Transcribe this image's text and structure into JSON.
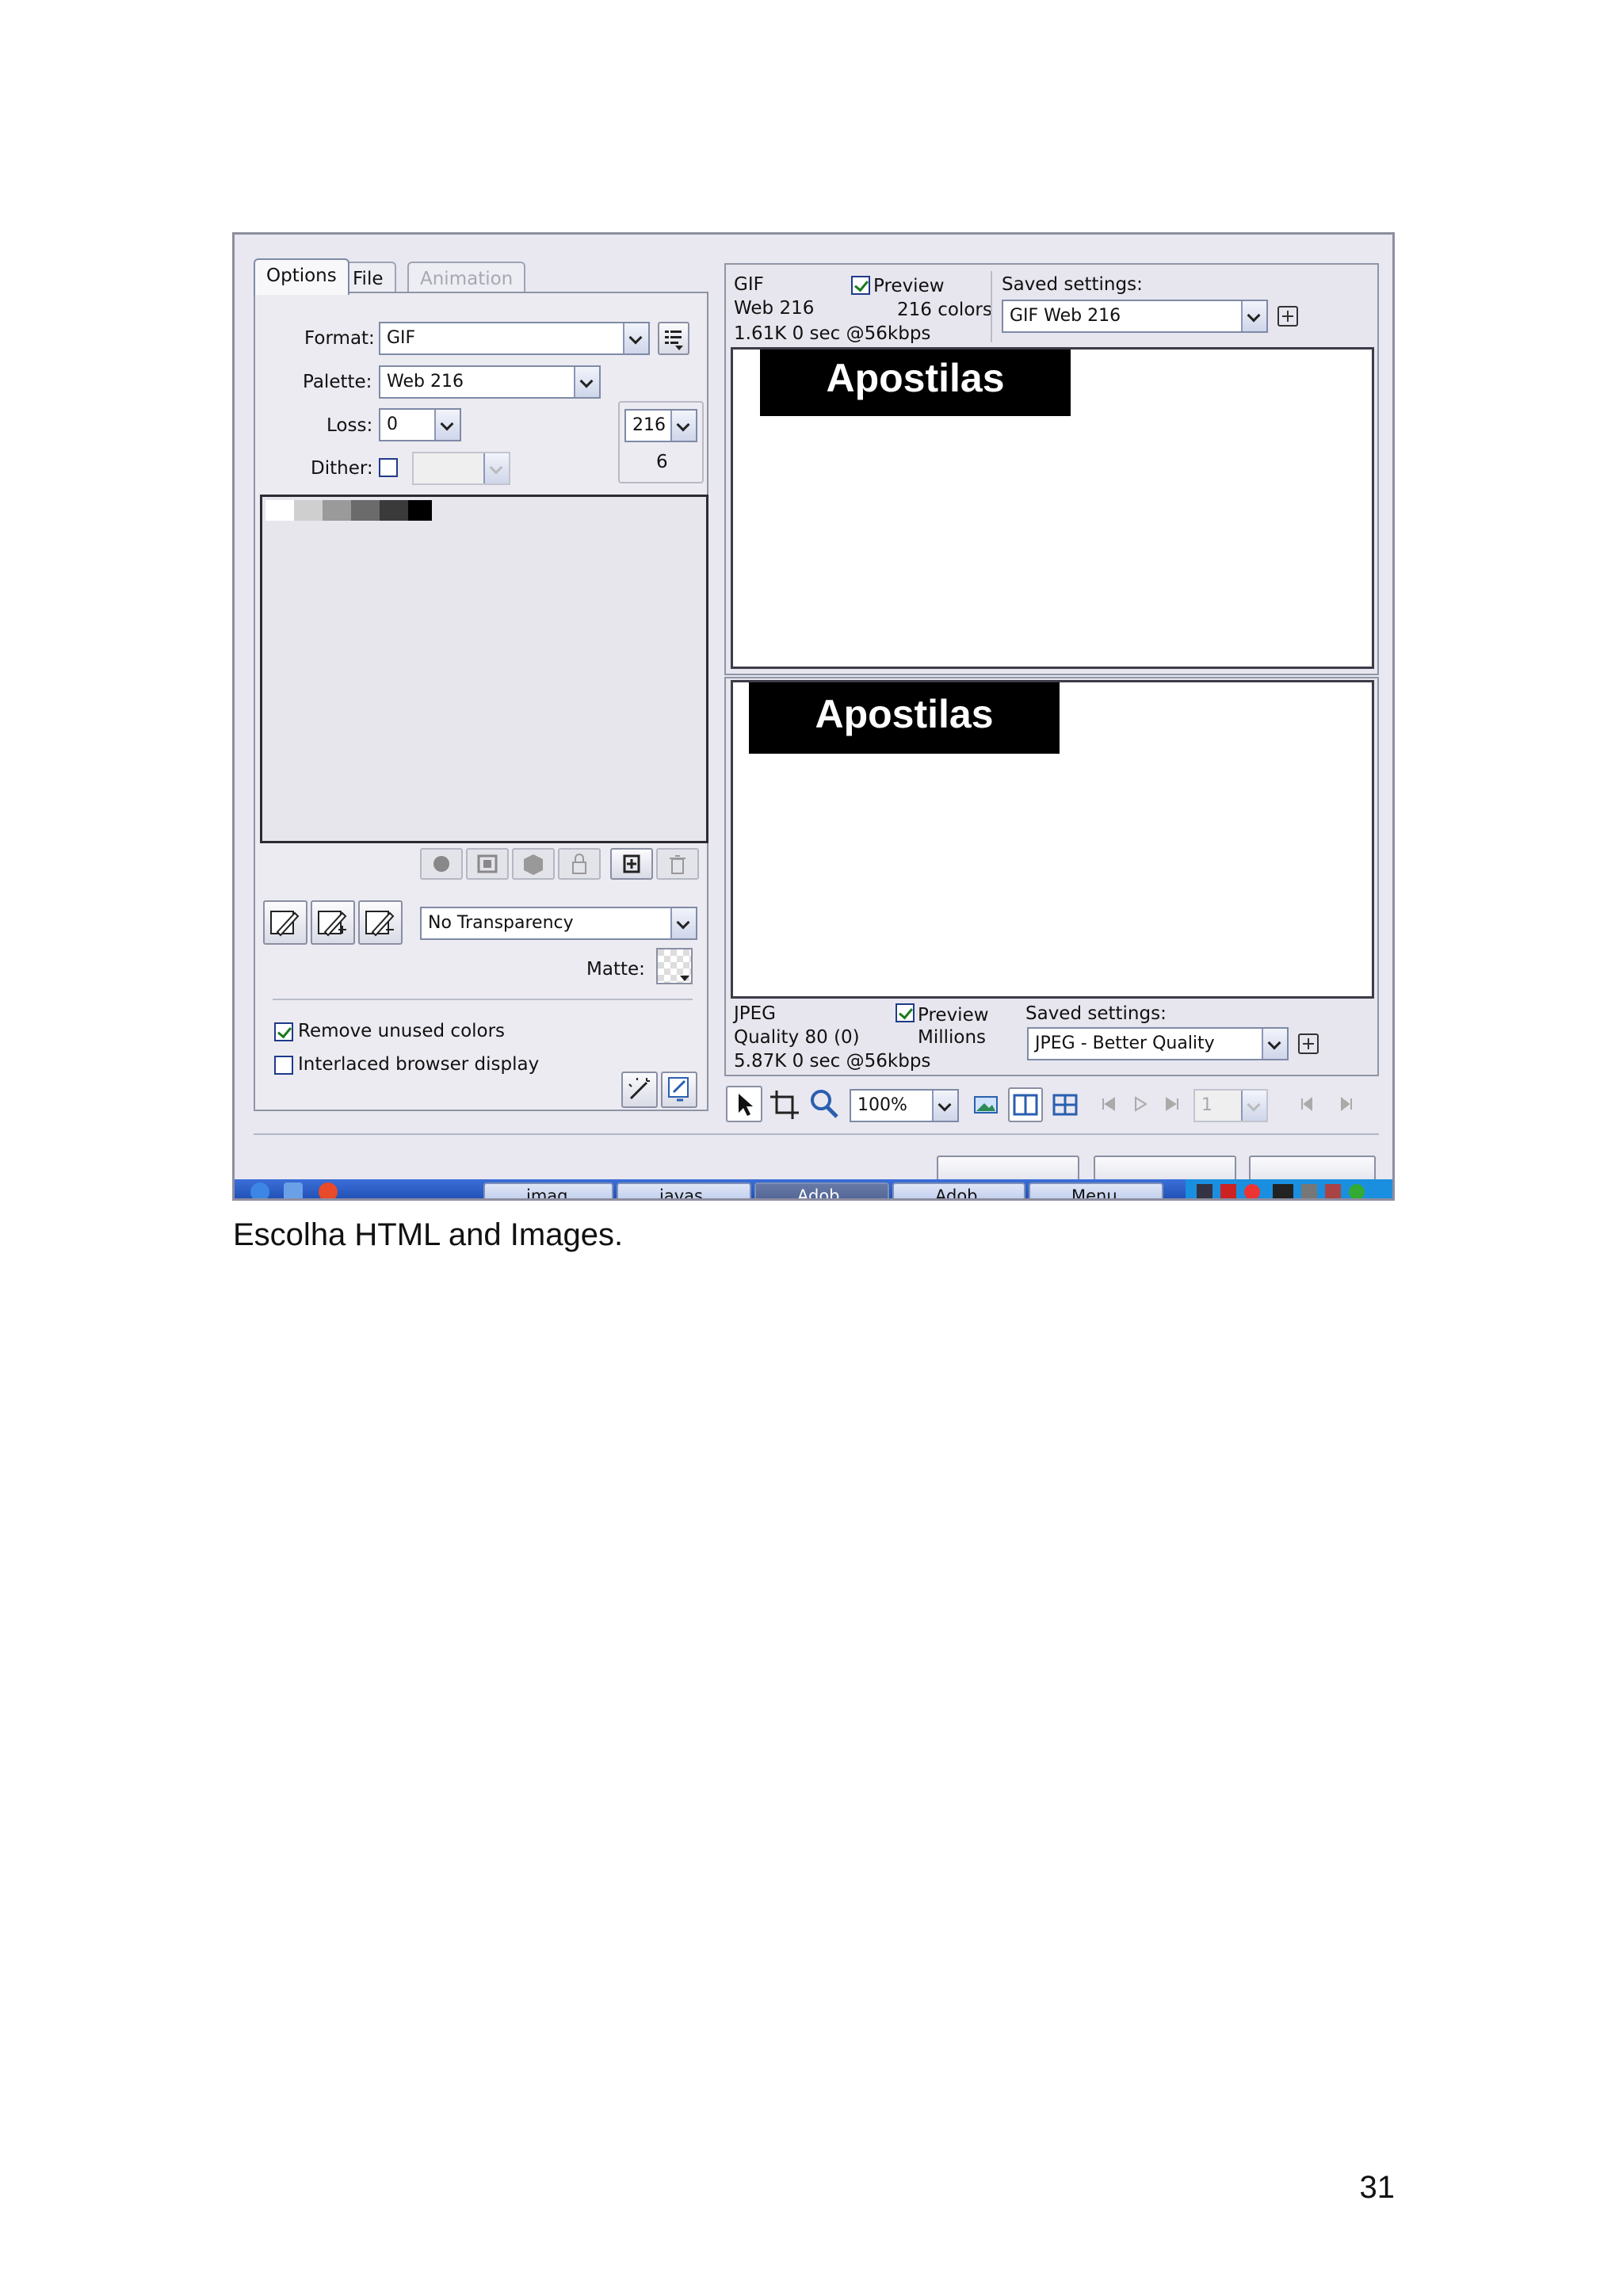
{
  "tabs": [
    "Options",
    "File",
    "Animation"
  ],
  "options": {
    "format_label": "Format:",
    "format_value": "GIF",
    "palette_label": "Palette:",
    "palette_value": "Web 216",
    "loss_label": "Loss:",
    "loss_value": "0",
    "dither_label": "Dither:",
    "colors_value": "216",
    "colors_count": "6",
    "transparency_value": "No Transparency",
    "matte_label": "Matte:",
    "remove_unused": "Remove unused colors",
    "interlaced": "Interlaced browser display"
  },
  "gif_preview": {
    "format": "GIF",
    "palette": "Web 216",
    "colors": "216 colors",
    "stats": "1.61K  0 sec @56kbps",
    "preview_label": "Preview",
    "saved_settings_label": "Saved settings:",
    "saved_settings_value": "GIF Web 216",
    "image_text": "Apostilas"
  },
  "jpeg_preview": {
    "format": "JPEG",
    "quality": "Quality 80 (0)",
    "colors": "Millions",
    "stats": "5.87K  0 sec @56kbps",
    "preview_label": "Preview",
    "saved_settings_label": "Saved settings:",
    "saved_settings_value": "JPEG - Better Quality",
    "image_text": "Apostilas"
  },
  "toolbar": {
    "zoom": "100%",
    "frame": "1"
  },
  "taskbar": [
    "imag",
    "javas",
    "Adob",
    "Adob",
    "Menu"
  ],
  "caption": "Escolha HTML and Images.",
  "page_number": "31"
}
